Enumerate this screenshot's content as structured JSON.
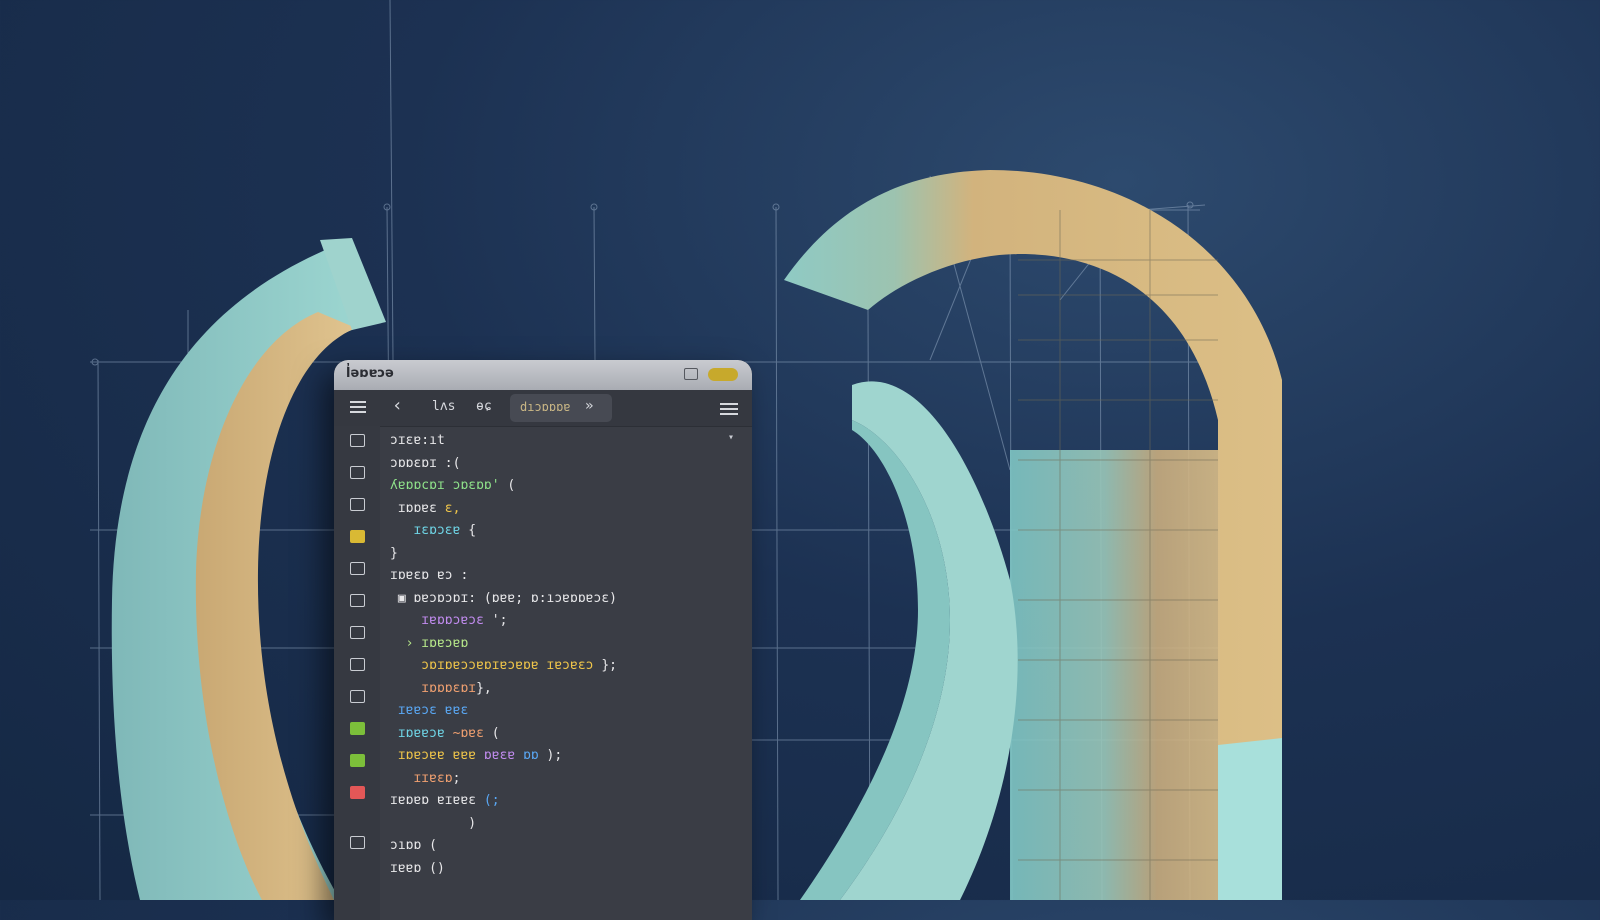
{
  "editor": {
    "title": "l̓əɒɐɔə",
    "toolbar": {
      "item1": "lʌs",
      "item2": "ɵɕ",
      "tab_label": "dıɔɒɒɒɐ",
      "tab_close": "»",
      "back": "‹"
    },
    "gutter_icons": [
      "folder-icon",
      "file-icon",
      "search-icon",
      "bookmark-icon",
      "home-icon",
      "image-icon",
      "document-icon",
      "git-icon",
      "extension-icon",
      "debug-icon",
      "bug-icon",
      "clipboard-icon",
      "cloud-icon"
    ],
    "code_lines": [
      [
        {
          "t": "ɔɪɛɐ:ıt",
          "c": "w"
        }
      ],
      [
        {
          "t": "ɔɒɒɛɒɪ :(",
          "c": "w"
        }
      ],
      [
        {
          "t": "ʎɐɒɒcɒɪ ɔɒɛɒɒ'",
          "c": "g"
        },
        {
          "t": " (",
          "c": "w"
        }
      ],
      [
        {
          "t": " ɪɒɒɐɛ ",
          "c": "w"
        },
        {
          "t": "ɛ,",
          "c": "y"
        }
      ],
      [
        {
          "t": "   ɪɛɒɔɛɐ ",
          "c": "c"
        },
        {
          "t": "{",
          "c": "w"
        }
      ],
      [
        {
          "t": "}",
          "c": "w"
        }
      ],
      [
        {
          "t": "ɪɒɐɛɒ ɐɔ :",
          "c": "w"
        }
      ],
      [
        {
          "t": " ▣ ɒɐɔɒɔɒɪ: (ɒɐɐ; ɒ:ıɔɐɒɒɐɔɛ)",
          "c": "w"
        }
      ],
      [
        {
          "t": "    ɪɐɒɒɔɐɔɛ ",
          "c": "p"
        },
        {
          "t": "';",
          "c": "w"
        }
      ],
      [
        {
          "t": "  › ɪɒɐɔɐɒ",
          "c": "l"
        }
      ],
      [
        {
          "t": "    ɔɒɪɒɐɔɔɐɒɪɐɔɐɒɐ ɪɐɔɐɛɔ ",
          "c": "y"
        },
        {
          "t": "};",
          "c": "w"
        }
      ],
      [
        {
          "t": "    ɪɒɒɒɛɒɪ",
          "c": "o"
        },
        {
          "t": "},",
          "c": "w"
        }
      ],
      [
        {
          "t": " ɪɐɐɔɛ ɐɐɛ",
          "c": "b"
        }
      ],
      [
        {
          "t": " ɪɒɐɐɔɐ ",
          "c": "c"
        },
        {
          "t": "~ɒɐɛ",
          "c": "o"
        },
        {
          "t": " (",
          "c": "w"
        }
      ],
      [
        {
          "t": " ɪɒɐɔɐɐ ɐɐɐ ",
          "c": "y"
        },
        {
          "t": "ɒɐɛɐ ",
          "c": "p"
        },
        {
          "t": "ɒɒ",
          "c": "b"
        },
        {
          "t": " );",
          "c": "w"
        }
      ],
      [
        {
          "t": "   ɪɪɐɛɒ",
          "c": "o"
        },
        {
          "t": ";",
          "c": "w"
        }
      ],
      [
        {
          "t": "ɪɐɒɐɒ ɐɪɐɐɛ ",
          "c": "w"
        },
        {
          "t": "(;",
          "c": "b"
        }
      ],
      [
        {
          "t": "          )",
          "c": "w"
        }
      ],
      [
        {
          "t": "ɔıɒɒ (",
          "c": "w"
        }
      ],
      [
        {
          "t": "ɪɐɐɒ ()",
          "c": "w"
        }
      ]
    ]
  },
  "colors": {
    "background": "#1c3152",
    "teal": "#8fcfca",
    "sand": "#d3b47e",
    "editor_bg": "#3a3d45"
  }
}
